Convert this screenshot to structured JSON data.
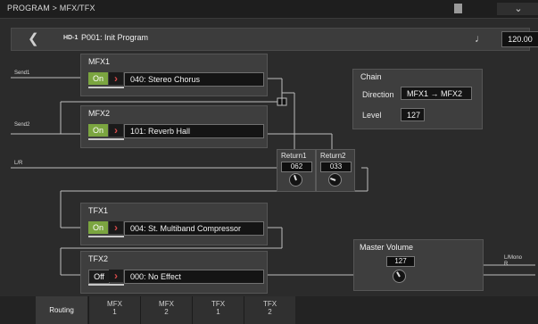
{
  "header": {
    "title": "PROGRAM > MFX/TFX",
    "menu_icon": "chevron-down-icon"
  },
  "program": {
    "bank": "HD-1",
    "name": "P001: Init Program",
    "tempo": "120.00",
    "note_icon": "quarter-note-icon"
  },
  "routing_labels": {
    "send1": "Send1",
    "send2": "Send2",
    "lr": "L/R",
    "out": "L/Mono\nR"
  },
  "mfx1": {
    "title": "MFX1",
    "state": "On",
    "effect": "040: Stereo Chorus"
  },
  "mfx2": {
    "title": "MFX2",
    "state": "On",
    "effect": "101: Reverb Hall"
  },
  "tfx1": {
    "title": "TFX1",
    "state": "On",
    "effect": "004: St. Multiband Compressor"
  },
  "tfx2": {
    "title": "TFX2",
    "state": "Off",
    "effect": "000: No Effect"
  },
  "chain": {
    "title": "Chain",
    "direction_label": "Direction",
    "direction_value": "MFX1 → MFX2",
    "level_label": "Level",
    "level_value": "127"
  },
  "returns": [
    {
      "label": "Return1",
      "value": "062"
    },
    {
      "label": "Return2",
      "value": "033"
    }
  ],
  "master": {
    "title": "Master Volume",
    "value": "127"
  },
  "tabs": [
    {
      "line1": "Routing",
      "line2": ""
    },
    {
      "line1": "MFX",
      "line2": "1"
    },
    {
      "line1": "MFX",
      "line2": "2"
    },
    {
      "line1": "TFX",
      "line2": "1"
    },
    {
      "line1": "TFX",
      "line2": "2"
    }
  ],
  "colors": {
    "on": "#7ba540",
    "accent_arrow": "#d84a4a",
    "background": "#2b2b2b"
  }
}
